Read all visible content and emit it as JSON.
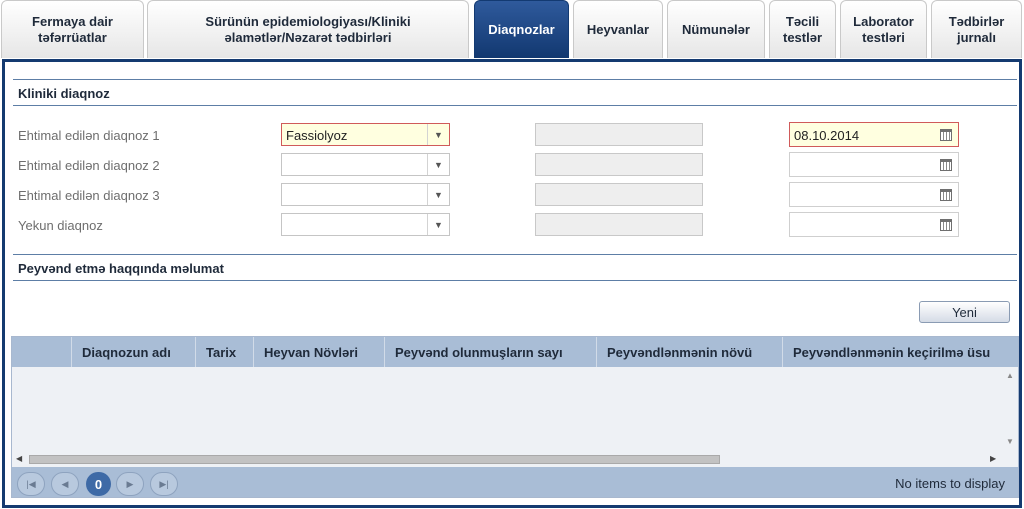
{
  "tabs": [
    {
      "label": "Fermaya dair\ntəfərrüatlar"
    },
    {
      "label": "Sürünün epidemiologiyası/Kliniki\nəlamətlər/Nəzarət tədbirləri"
    },
    {
      "label": "Diaqnozlar"
    },
    {
      "label": "Heyvanlar"
    },
    {
      "label": "Nümunələr"
    },
    {
      "label": "Təcili\ntestlər"
    },
    {
      "label": "Laborator\ntestləri"
    },
    {
      "label": "Tədbirlər\njurnalı"
    }
  ],
  "active_tab": "Diaqnozlar",
  "clinical": {
    "title": "Kliniki diaqnoz",
    "rows": [
      {
        "label": "Ehtimal edilən diaqnoz 1",
        "combo_value": "Fassiolyoz",
        "date_value": "08.10.2014"
      },
      {
        "label": "Ehtimal edilən diaqnoz 2",
        "combo_value": "",
        "date_value": ""
      },
      {
        "label": "Ehtimal edilən diaqnoz 3",
        "combo_value": "",
        "date_value": ""
      },
      {
        "label": "Yekun diaqnoz",
        "combo_value": "",
        "date_value": ""
      }
    ]
  },
  "vaccination": {
    "title": "Peyvənd etmə haqqında məlumat",
    "new_button": "Yeni",
    "columns": [
      "",
      "Diaqnozun adı",
      "Tarix",
      "Heyvan Növləri",
      "Peyvənd olunmuşların sayı",
      "Peyvəndlənmənin növü",
      "Peyvəndlənmənin keçirilmə üsu"
    ],
    "pager": {
      "current_page": "0",
      "status": "No items to display"
    }
  },
  "icons": {
    "combo_arrow": "chevron-down-icon",
    "calendar": "calendar-icon",
    "pager_first": "first-page-icon",
    "pager_prev": "prev-page-icon",
    "pager_next": "next-page-icon",
    "pager_last": "last-page-icon"
  },
  "colors": {
    "active_tab": "#1b447f",
    "frame": "#143a70",
    "required_fill": "#ffffe0",
    "required_border": "#d05a5a",
    "grid_header": "#a9bdd6"
  }
}
